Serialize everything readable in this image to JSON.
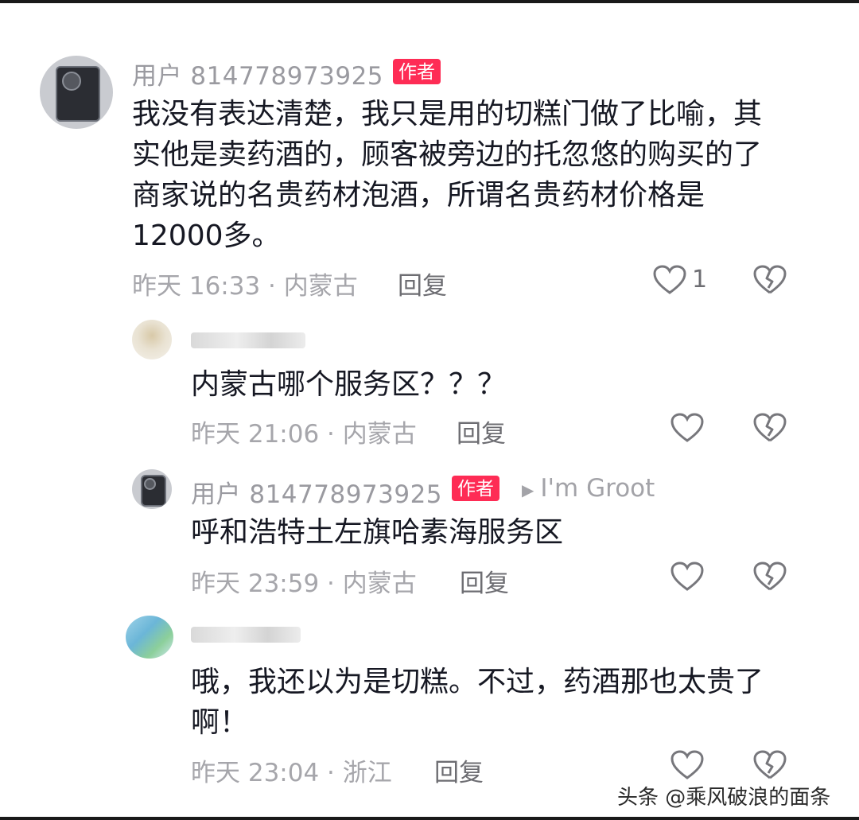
{
  "comments": [
    {
      "username": "用户 814778973925",
      "badge": "作者",
      "text": "我没有表达清楚，我只是用的切糕门做了比喻，其实他是卖药酒的，顾客被旁边的托忽悠的购买的了商家说的名贵药材泡酒，所谓名贵药材价格是12000多。",
      "meta": "昨天 16:33 · 内蒙古",
      "reply_label": "回复",
      "like_count": "1"
    },
    {
      "username": "",
      "text": "内蒙古哪个服务区？？？",
      "meta": "昨天 21:06 · 内蒙古",
      "reply_label": "回复"
    },
    {
      "username": "用户 814778973925",
      "badge": "作者",
      "reply_to": "I'm Groot",
      "text": "呼和浩特土左旗哈素海服务区",
      "meta": "昨天 23:59 · 内蒙古",
      "reply_label": "回复"
    },
    {
      "username": "",
      "text": "哦，我还以为是切糕。不过，药酒那也太贵了啊！",
      "meta": "昨天 23:04 · 浙江",
      "reply_label": "回复"
    }
  ],
  "watermark": "头条 @乘风破浪的面条",
  "icons": {
    "like": "heart-outline-icon",
    "dislike": "broken-heart-icon",
    "reply_arrow": "triangle-right-icon"
  }
}
